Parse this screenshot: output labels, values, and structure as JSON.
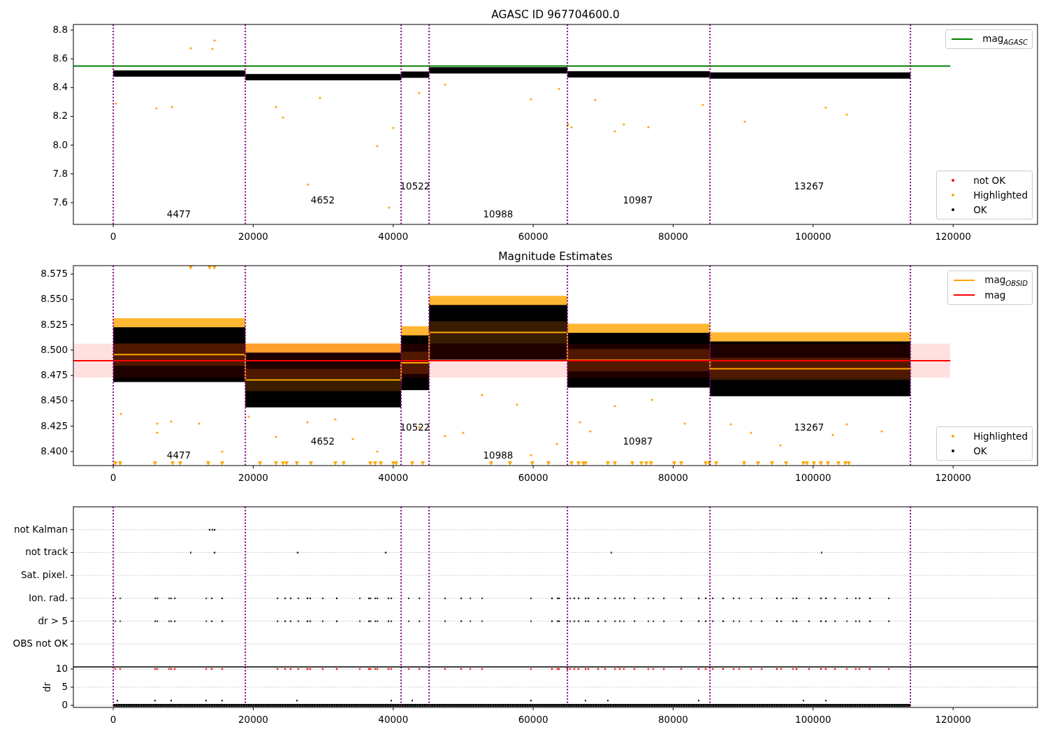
{
  "panels": [
    {
      "kind": "agasc",
      "chart_data": {
        "type": "line",
        "title": "AGASC ID 967704600.0",
        "xlim": [
          -5700,
          132060
        ],
        "ylim": [
          7.449,
          8.839
        ],
        "xticks": [
          0,
          20000,
          40000,
          60000,
          80000,
          100000,
          120000
        ],
        "yticks": [
          {
            "value": 7.6,
            "label": "7.6"
          },
          {
            "value": 7.8,
            "label": "7.8"
          },
          {
            "value": 8.0,
            "label": "8.0"
          },
          {
            "value": 8.2,
            "label": "8.2"
          },
          {
            "value": 8.4,
            "label": "8.4"
          },
          {
            "value": 8.6,
            "label": "8.6"
          },
          {
            "value": 8.8,
            "label": "8.8"
          }
        ],
        "series": [
          {
            "name": "mag$_{AGASC}$",
            "color": "#008000",
            "x": [
              -5700,
              119600
            ],
            "values": [
              8.55,
              8.55
            ]
          }
        ],
        "ref_lines": [
          {
            "axis": "x",
            "value": 0,
            "color": "#800080"
          },
          {
            "axis": "x",
            "value": 18870,
            "color": "#800080"
          },
          {
            "axis": "x",
            "value": 41130,
            "color": "#800080"
          },
          {
            "axis": "x",
            "value": 45130,
            "color": "#800080"
          },
          {
            "axis": "x",
            "value": 64890,
            "color": "#800080"
          },
          {
            "axis": "x",
            "value": 85260,
            "color": "#800080"
          },
          {
            "axis": "x",
            "value": 113900,
            "color": "#800080"
          }
        ],
        "annotations": [
          "4477",
          "4652",
          "10522",
          "10988",
          "10987",
          "13267"
        ]
      },
      "markers": [
        {
          "label": "not OK",
          "color": "#ff0000"
        },
        {
          "label": "Highlighted",
          "color": "#ffa500"
        },
        {
          "label": "OK",
          "color": "#000000"
        }
      ]
    },
    {
      "kind": "estimates",
      "chart_data": {
        "type": "line",
        "title": "Magnitude Estimates",
        "xlim": [
          -5700,
          132060
        ],
        "ylim": [
          8.3861,
          8.5833
        ],
        "xticks": [
          0,
          20000,
          40000,
          60000,
          80000,
          100000,
          120000
        ],
        "yticks": [
          {
            "value": 8.4,
            "label": "8.400"
          },
          {
            "value": 8.425,
            "label": "8.425"
          },
          {
            "value": 8.45,
            "label": "8.450"
          },
          {
            "value": 8.475,
            "label": "8.475"
          },
          {
            "value": 8.5,
            "label": "8.500"
          },
          {
            "value": 8.525,
            "label": "8.525"
          },
          {
            "value": 8.55,
            "label": "8.550"
          },
          {
            "value": 8.575,
            "label": "8.575"
          }
        ],
        "series": [
          {
            "name": "mag$_{OBSID}$",
            "color": "#ffa500",
            "x": [
              0,
              18870,
              18870,
              41130,
              41130,
              45130,
              45130,
              64890,
              64890,
              85260,
              85260,
              113900
            ],
            "values": [
              8.4955,
              8.4955,
              8.4705,
              8.4705,
              8.4875,
              8.4875,
              8.5175,
              8.5175,
              8.49,
              8.49,
              8.4815,
              8.4815
            ]
          },
          {
            "name": "mag",
            "color": "#ff0000",
            "x": [
              -5700,
              119600
            ],
            "values": [
              8.4896,
              8.4896
            ]
          }
        ],
        "bands": [
          {
            "axis": "y",
            "from": 8.4729,
            "to": 8.5063,
            "color": "#ff0000"
          }
        ],
        "ref_lines": [
          {
            "axis": "x",
            "value": 0,
            "color": "#800080"
          },
          {
            "axis": "x",
            "value": 18870,
            "color": "#800080"
          },
          {
            "axis": "x",
            "value": 41130,
            "color": "#800080"
          },
          {
            "axis": "x",
            "value": 45130,
            "color": "#800080"
          },
          {
            "axis": "x",
            "value": 64890,
            "color": "#800080"
          },
          {
            "axis": "x",
            "value": 85260,
            "color": "#800080"
          },
          {
            "axis": "x",
            "value": 113900,
            "color": "#800080"
          }
        ],
        "annotations": [
          "4477",
          "4652",
          "10522",
          "10988",
          "10987",
          "13267"
        ]
      },
      "markers": [
        {
          "label": "Highlighted",
          "color": "#ffa500"
        },
        {
          "label": "OK",
          "color": "#000000"
        }
      ]
    },
    {
      "kind": "flags",
      "rows": [
        "not Kalman",
        "not track",
        "Sat. pixel.",
        "Ion. rad.",
        "dr > 5",
        "OBS not OK"
      ]
    },
    {
      "kind": "dr",
      "chart_data": {
        "type": "scatter",
        "ylabel": "dr",
        "grid": true,
        "xlim": [
          -5700,
          132060
        ],
        "ylim": [
          -0.58,
          10.58
        ],
        "xticks": [
          0,
          20000,
          40000,
          60000,
          80000,
          100000,
          120000
        ],
        "yticks": [
          0,
          5,
          10
        ],
        "ref_lines": [
          {
            "axis": "x",
            "value": 0,
            "color": "#800080"
          },
          {
            "axis": "x",
            "value": 18870,
            "color": "#800080"
          },
          {
            "axis": "x",
            "value": 41130,
            "color": "#800080"
          },
          {
            "axis": "x",
            "value": 45130,
            "color": "#800080"
          },
          {
            "axis": "x",
            "value": 64890,
            "color": "#800080"
          },
          {
            "axis": "x",
            "value": 85260,
            "color": "#800080"
          },
          {
            "axis": "x",
            "value": 113900,
            "color": "#800080"
          }
        ]
      }
    }
  ]
}
